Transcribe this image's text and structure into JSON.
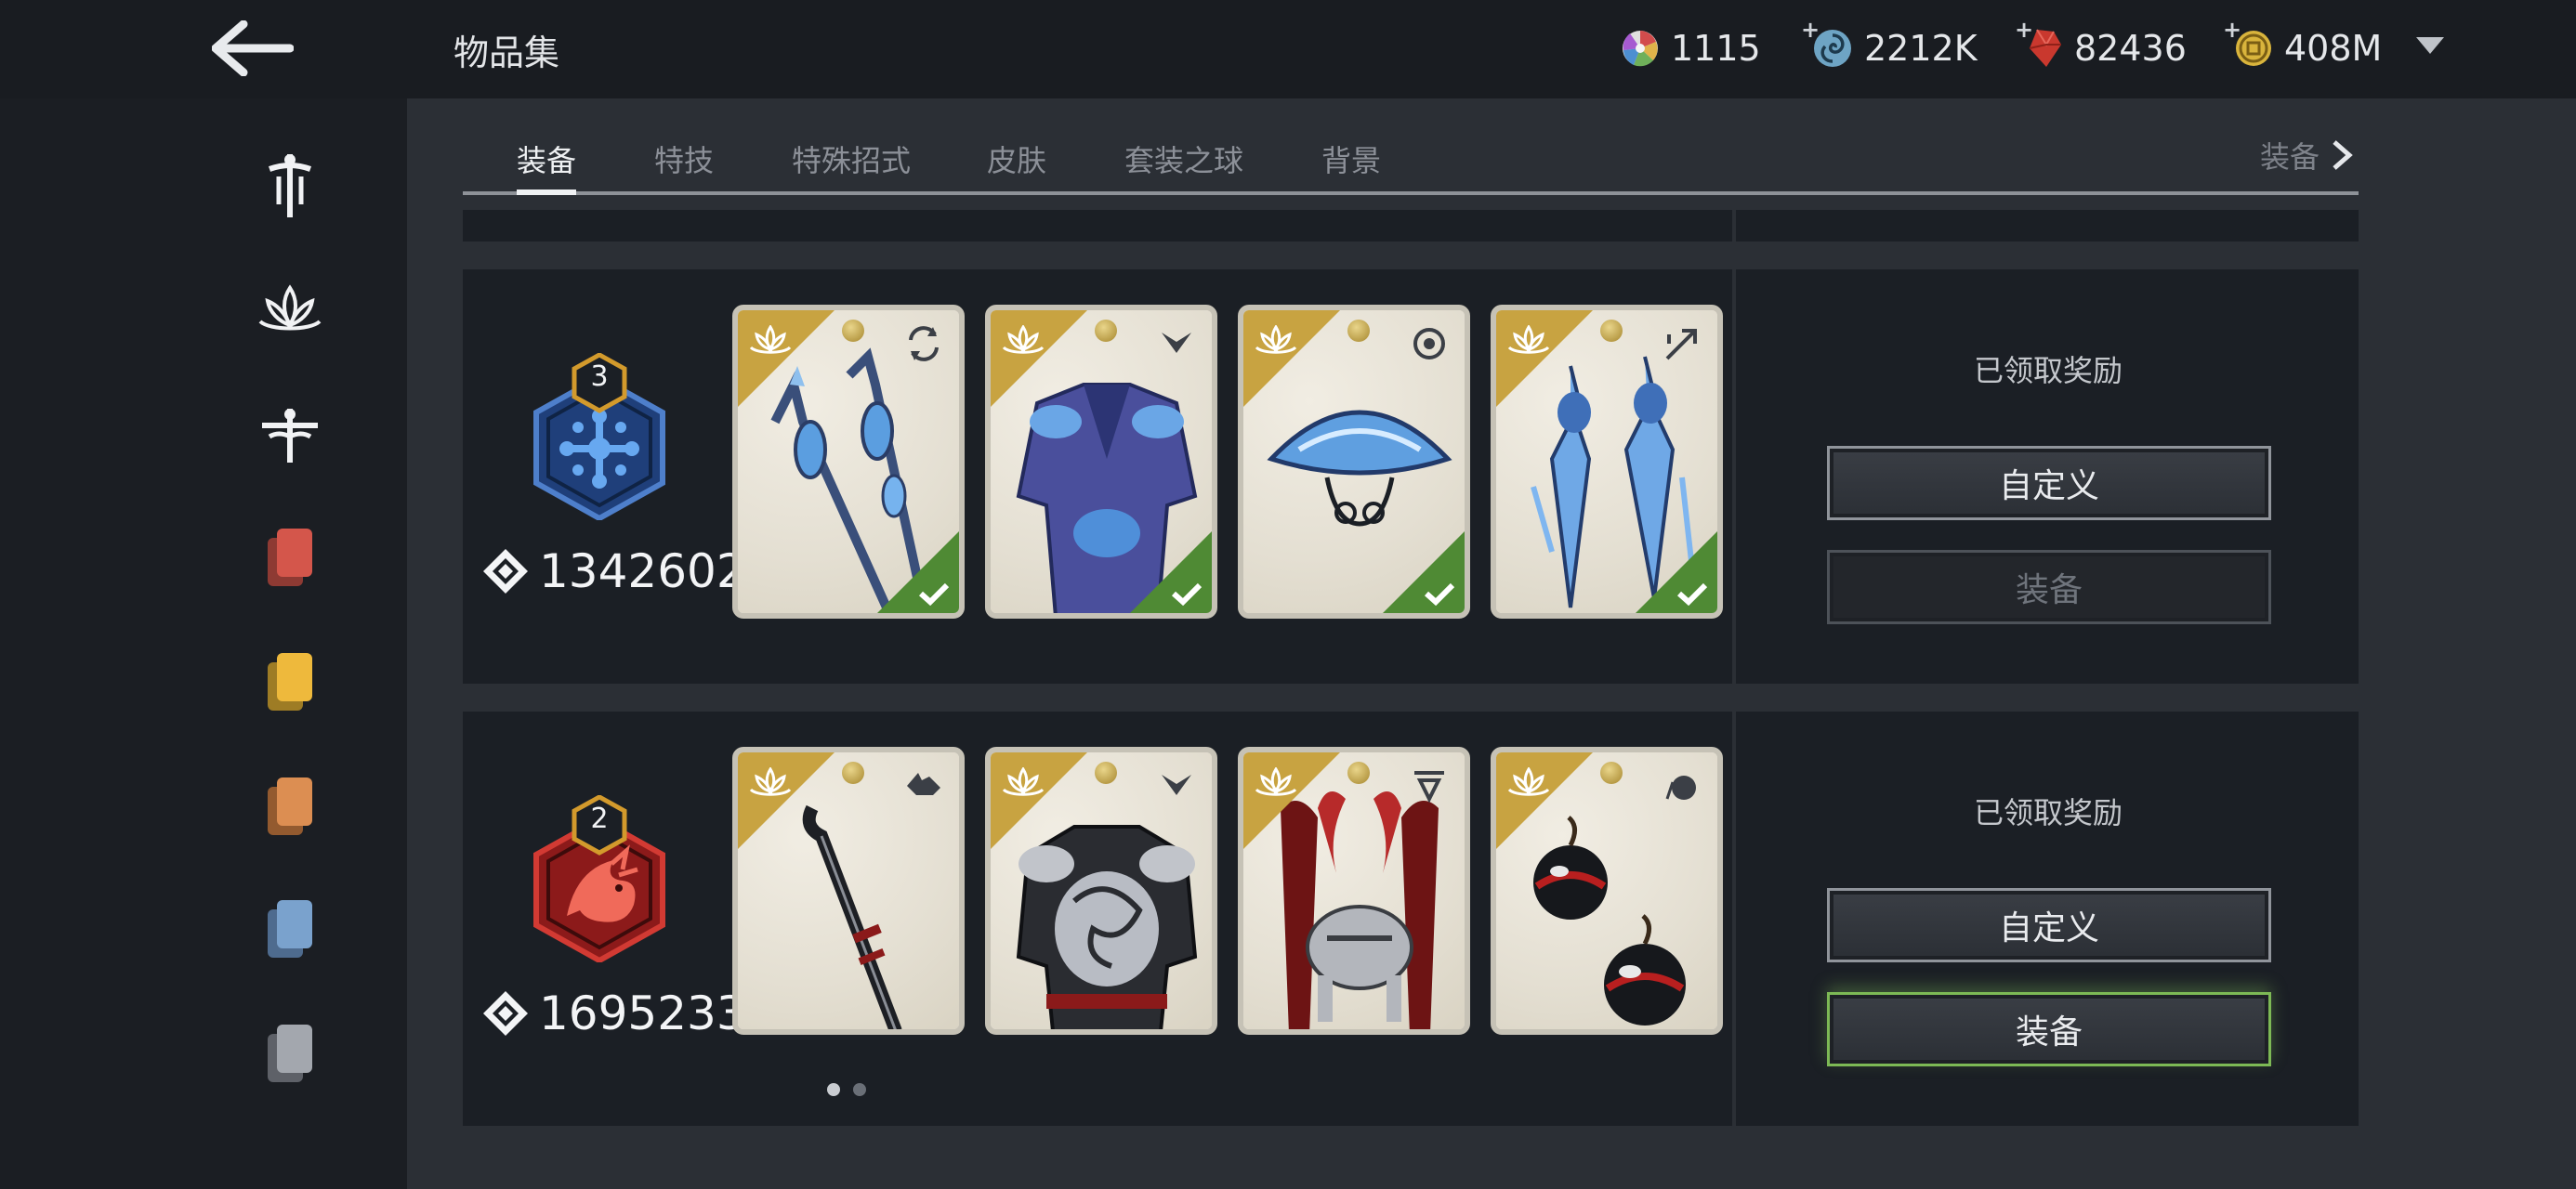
{
  "header": {
    "title": "物品集",
    "back_icon": "arrow-left-icon"
  },
  "currencies": [
    {
      "icon": "color-wheel-icon",
      "value": "1115",
      "plus": false
    },
    {
      "icon": "swirl-token-icon",
      "value": "2212K",
      "plus": true
    },
    {
      "icon": "red-gem-icon",
      "value": "82436",
      "plus": true
    },
    {
      "icon": "gold-coin-icon",
      "value": "408M",
      "plus": true
    }
  ],
  "sidebar": {
    "items": [
      {
        "icon": "sword-emblem-icon"
      },
      {
        "icon": "lotus-emblem-icon"
      },
      {
        "icon": "dragonfly-emblem-icon"
      },
      {
        "icon": "card-stack-red-icon"
      },
      {
        "icon": "card-stack-yellow-icon"
      },
      {
        "icon": "card-stack-orange-icon"
      },
      {
        "icon": "card-stack-blue-icon"
      },
      {
        "icon": "card-stack-grey-icon"
      }
    ]
  },
  "tabs": [
    "装备",
    "特技",
    "特殊招式",
    "皮肤",
    "套装之球",
    "背景"
  ],
  "active_tab": "装备",
  "tab_next": "装备",
  "sets": [
    {
      "level": "3",
      "emblem": "blue-snowflake-emblem",
      "power": "1342602",
      "reward_status": "已领取奖励",
      "customize_label": "自定义",
      "equip_label": "装备",
      "equip_enabled": false,
      "items": [
        {
          "type_icon": "weapon-swap-icon",
          "equipped": true
        },
        {
          "type_icon": "armor-chevron-icon",
          "equipped": true
        },
        {
          "type_icon": "helmet-eye-icon",
          "equipped": true
        },
        {
          "type_icon": "ranged-weapon-icon",
          "equipped": true
        }
      ]
    },
    {
      "level": "2",
      "emblem": "red-dragon-emblem",
      "power": "1695233",
      "reward_status": "已领取奖励",
      "customize_label": "自定义",
      "equip_label": "装备",
      "equip_enabled": true,
      "items": [
        {
          "type_icon": "wolf-head-icon",
          "equipped": false
        },
        {
          "type_icon": "armor-chevron-icon",
          "equipped": false
        },
        {
          "type_icon": "helmet-plume-icon",
          "equipped": false
        },
        {
          "type_icon": "bomb-icon",
          "equipped": false
        }
      ]
    }
  ],
  "pager": {
    "pages": 2,
    "current": 1
  }
}
